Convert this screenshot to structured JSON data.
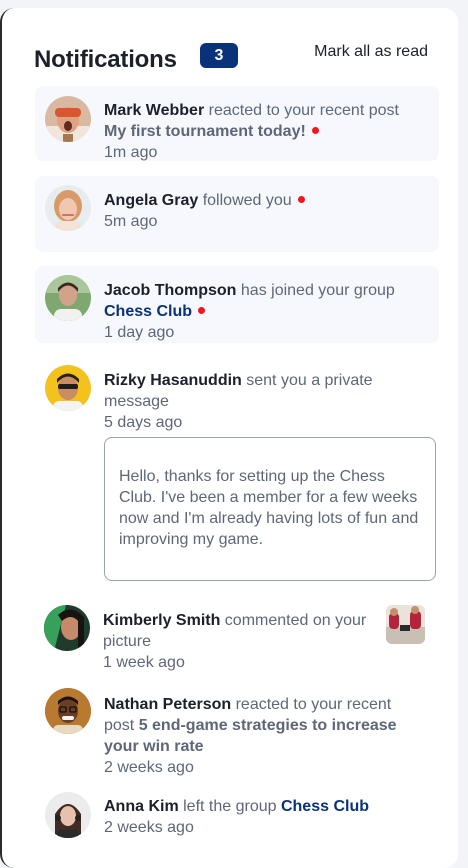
{
  "header": {
    "title": "Notifications",
    "unread_count": "3",
    "mark_all_label": "Mark all as read"
  },
  "notifications": [
    {
      "name": "Mark Webber",
      "action": " reacted to your recent post",
      "target": "My first tournament today!",
      "time": "1m ago",
      "unread": true,
      "avatar_icon": "mark-webber-avatar"
    },
    {
      "name": "Angela Gray",
      "action": " followed you",
      "time": "5m ago",
      "unread": true,
      "avatar_icon": "angela-gray-avatar"
    },
    {
      "name": "Jacob Thompson",
      "action": " has joined your group",
      "target": "Chess Club",
      "time": "1 day ago",
      "unread": true,
      "avatar_icon": "jacob-thompson-avatar"
    },
    {
      "name": "Rizky Hasanuddin",
      "action": " sent you a private message",
      "time": "5 days ago",
      "unread": false,
      "message": "Hello, thanks for setting up the Chess Club. I've been a member for a few weeks now and I'm already having lots of fun and improving my game.",
      "avatar_icon": "rizky-hasanuddin-avatar"
    },
    {
      "name": "Kimberly Smith",
      "action": " commented on your picture",
      "time": "1 week ago",
      "unread": false,
      "avatar_icon": "kimberly-smith-avatar",
      "thumb_icon": "chess-picture-thumbnail"
    },
    {
      "name": "Nathan Peterson",
      "action": " reacted to your recent post ",
      "target": "5 end-game strategies to increase your win rate",
      "time": "2 weeks ago",
      "unread": false,
      "avatar_icon": "nathan-peterson-avatar"
    },
    {
      "name": "Anna Kim",
      "action": " left the group ",
      "target": "Chess Club",
      "time": "2 weeks ago",
      "unread": false,
      "avatar_icon": "anna-kim-avatar"
    }
  ],
  "colors": {
    "accent": "#0a327b",
    "unread_dot": "#f4151e",
    "unread_bg": "#f6f8fd",
    "heading": "#1c202b",
    "body_text": "#5e6778"
  }
}
